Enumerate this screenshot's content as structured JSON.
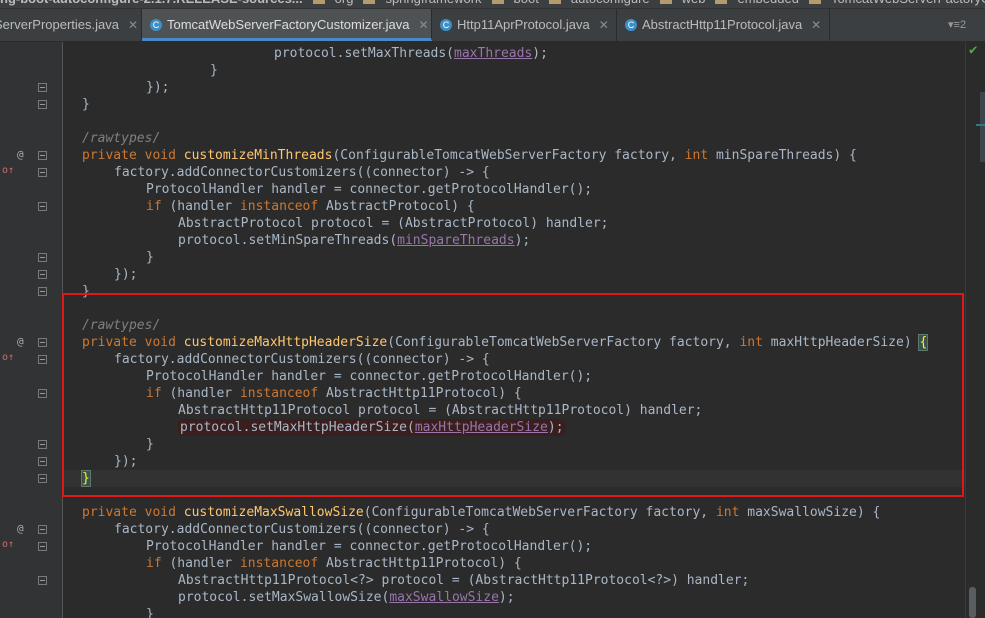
{
  "breadcrumbs": [
    {
      "label": "ng-boot-autoconfigure-2.1.7.RELEASE-sources...",
      "bold": true
    },
    {
      "label": "org"
    },
    {
      "label": "springframework"
    },
    {
      "label": "boot"
    },
    {
      "label": "autoconfigure"
    },
    {
      "label": "web"
    },
    {
      "label": "embedded"
    },
    {
      "label": "TomcatWebServerFactoryC"
    }
  ],
  "tabs": [
    {
      "label": "ServerProperties.java",
      "active": false,
      "closable": true
    },
    {
      "label": "TomcatWebServerFactoryCustomizer.java",
      "active": true,
      "closable": true
    },
    {
      "label": "Http11AprProtocol.java",
      "active": false,
      "closable": true
    },
    {
      "label": "AbstractHttp11Protocol.java",
      "active": false,
      "closable": true
    }
  ],
  "tab_menu": "▾≡2",
  "close_glyph": "✕",
  "code": {
    "lines": [
      {
        "indent": 24,
        "tokens": [
          [
            "protocol.setMaxThreads(",
            ""
          ],
          [
            "maxThreads",
            "fld"
          ],
          [
            ");",
            ""
          ]
        ]
      },
      {
        "indent": 16,
        "tokens": [
          [
            "}",
            ""
          ]
        ]
      },
      {
        "indent": 8,
        "tokens": [
          [
            "});",
            ""
          ]
        ]
      },
      {
        "indent": 0,
        "tokens": [
          [
            "}",
            ""
          ]
        ]
      },
      {
        "indent": 0,
        "tokens": []
      },
      {
        "indent": 0,
        "tokens": [
          [
            "/rawtypes/",
            "cmt"
          ]
        ]
      },
      {
        "indent": 0,
        "tokens": [
          [
            "private void ",
            "kw"
          ],
          [
            "customizeMinThreads",
            "mth"
          ],
          [
            "(ConfigurableTomcatWebServerFactory factory, ",
            ""
          ],
          [
            "int ",
            "kw"
          ],
          [
            "minSpareThreads) {",
            ""
          ]
        ]
      },
      {
        "indent": 4,
        "tokens": [
          [
            "factory.addConnectorCustomizers((connector) -> {",
            ""
          ]
        ]
      },
      {
        "indent": 8,
        "tokens": [
          [
            "ProtocolHandler handler = connector.getProtocolHandler();",
            ""
          ]
        ]
      },
      {
        "indent": 8,
        "tokens": [
          [
            "if ",
            "kw"
          ],
          [
            "(handler ",
            ""
          ],
          [
            "instanceof ",
            "kw"
          ],
          [
            "AbstractProtocol) {",
            ""
          ]
        ]
      },
      {
        "indent": 12,
        "tokens": [
          [
            "AbstractProtocol protocol = (AbstractProtocol) handler;",
            ""
          ]
        ]
      },
      {
        "indent": 12,
        "tokens": [
          [
            "protocol.setMinSpareThreads(",
            ""
          ],
          [
            "minSpareThreads",
            "fld"
          ],
          [
            ");",
            ""
          ]
        ]
      },
      {
        "indent": 8,
        "tokens": [
          [
            "}",
            ""
          ]
        ]
      },
      {
        "indent": 4,
        "tokens": [
          [
            "});",
            ""
          ]
        ]
      },
      {
        "indent": 0,
        "tokens": [
          [
            "}",
            ""
          ]
        ]
      },
      {
        "indent": 0,
        "tokens": []
      },
      {
        "indent": 0,
        "tokens": [
          [
            "/rawtypes/",
            "cmt"
          ]
        ]
      },
      {
        "indent": 0,
        "tokens": [
          [
            "private void ",
            "kw"
          ],
          [
            "customizeMaxHttpHeaderSize",
            "mth"
          ],
          [
            "(ConfigurableTomcatWebServerFactory factory, ",
            ""
          ],
          [
            "int ",
            "kw"
          ],
          [
            "maxHttpHeaderSize) ",
            ""
          ],
          [
            "{",
            "brace-match"
          ]
        ]
      },
      {
        "indent": 4,
        "tokens": [
          [
            "factory.addConnectorCustomizers((connector) -> {",
            ""
          ]
        ]
      },
      {
        "indent": 8,
        "tokens": [
          [
            "ProtocolHandler handler = connector.getProtocolHandler();",
            ""
          ]
        ]
      },
      {
        "indent": 8,
        "tokens": [
          [
            "if ",
            "kw"
          ],
          [
            "(handler ",
            ""
          ],
          [
            "instanceof ",
            "kw"
          ],
          [
            "AbstractHttp11Protocol) {",
            ""
          ]
        ]
      },
      {
        "indent": 12,
        "tokens": [
          [
            "AbstractHttp11Protocol protocol = (AbstractHttp11Protocol) handler;",
            ""
          ]
        ]
      },
      {
        "indent": 12,
        "hl": true,
        "tokens": [
          [
            "protocol.setMaxHttpHeaderSize(",
            ""
          ],
          [
            "maxHttpHeaderSize",
            "fld"
          ],
          [
            ");",
            ""
          ]
        ]
      },
      {
        "indent": 8,
        "tokens": [
          [
            "}",
            ""
          ]
        ]
      },
      {
        "indent": 4,
        "tokens": [
          [
            "});",
            ""
          ]
        ]
      },
      {
        "indent": 0,
        "caret": true,
        "tokens": [
          [
            "}",
            "brace-match"
          ]
        ]
      },
      {
        "indent": 0,
        "tokens": []
      },
      {
        "indent": 0,
        "tokens": [
          [
            "private void ",
            "kw"
          ],
          [
            "customizeMaxSwallowSize",
            "mth"
          ],
          [
            "(ConfigurableTomcatWebServerFactory factory, ",
            ""
          ],
          [
            "int ",
            "kw"
          ],
          [
            "maxSwallowSize) {",
            ""
          ]
        ]
      },
      {
        "indent": 4,
        "tokens": [
          [
            "factory.addConnectorCustomizers((connector) -> {",
            ""
          ]
        ]
      },
      {
        "indent": 8,
        "tokens": [
          [
            "ProtocolHandler handler = connector.getProtocolHandler();",
            ""
          ]
        ]
      },
      {
        "indent": 8,
        "tokens": [
          [
            "if ",
            "kw"
          ],
          [
            "(handler ",
            ""
          ],
          [
            "instanceof ",
            "kw"
          ],
          [
            "AbstractHttp11Protocol) {",
            ""
          ]
        ]
      },
      {
        "indent": 12,
        "tokens": [
          [
            "AbstractHttp11Protocol<?> protocol = (AbstractHttp11Protocol<?>) handler;",
            ""
          ]
        ]
      },
      {
        "indent": 12,
        "tokens": [
          [
            "protocol.setMaxSwallowSize(",
            ""
          ],
          [
            "maxSwallowSize",
            "fld"
          ],
          [
            ");",
            ""
          ]
        ]
      },
      {
        "indent": 8,
        "tokens": [
          [
            "}",
            ""
          ]
        ]
      }
    ]
  },
  "gutter": {
    "annotation_glyph": "@",
    "implements_glyph": "o↑"
  },
  "inspection_status_glyph": "✔"
}
